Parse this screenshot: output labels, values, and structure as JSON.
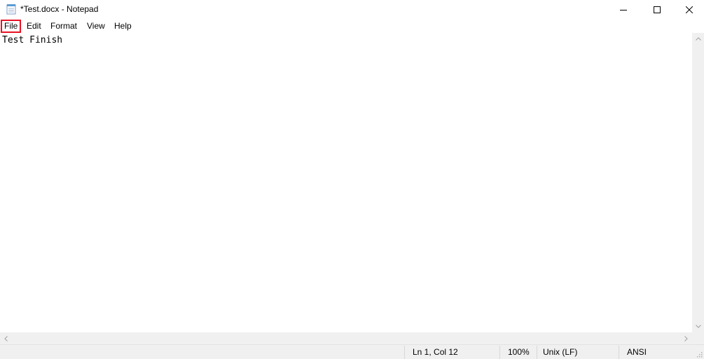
{
  "window": {
    "title": "*Test.docx - Notepad",
    "icon": "notepad-icon"
  },
  "caption_buttons": {
    "minimize_icon": "minimize-icon",
    "maximize_icon": "maximize-icon",
    "close_icon": "close-icon"
  },
  "menu": {
    "items": [
      {
        "label": "File",
        "highlighted": true,
        "highlight_color": "#e81123"
      },
      {
        "label": "Edit"
      },
      {
        "label": "Format"
      },
      {
        "label": "View"
      },
      {
        "label": "Help"
      }
    ]
  },
  "editor": {
    "content": "Test Finish"
  },
  "status": {
    "position": "Ln 1, Col 12",
    "zoom": "100%",
    "line_ending": "Unix (LF)",
    "encoding": "ANSI"
  }
}
